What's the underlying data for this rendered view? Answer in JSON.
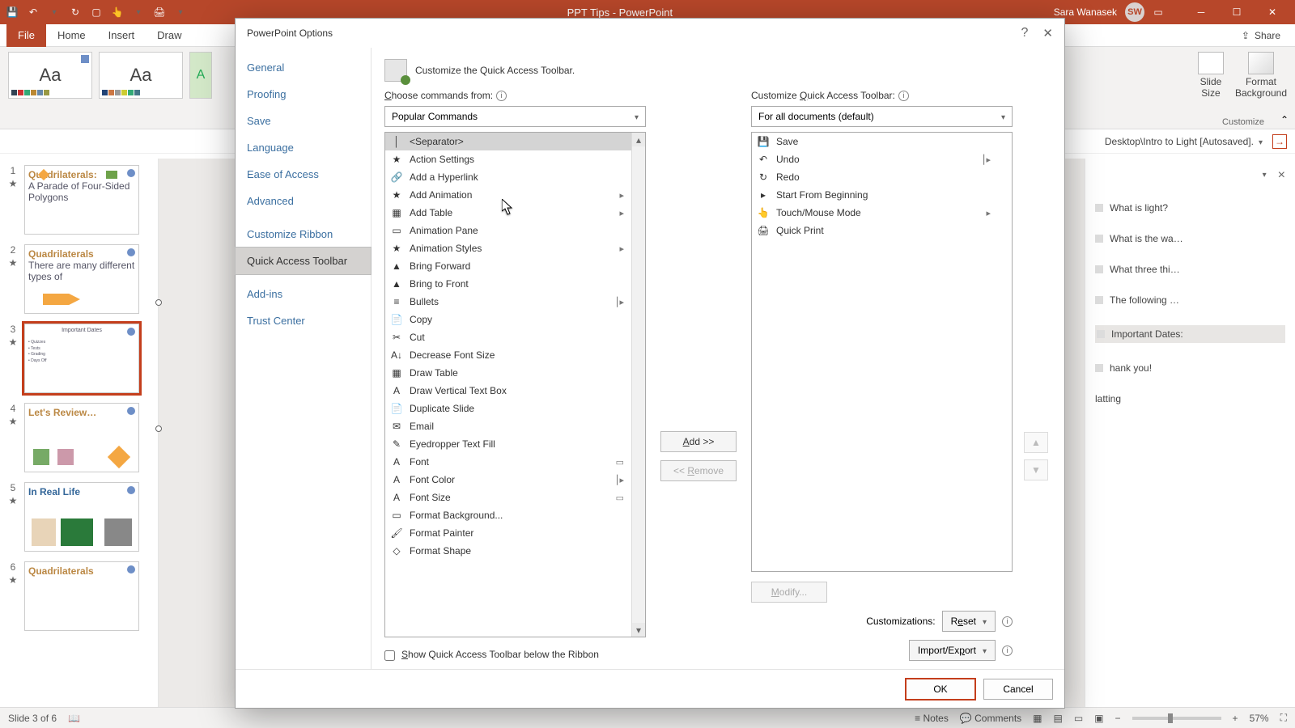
{
  "titlebar": {
    "doc_title": "PPT Tips - PowerPoint",
    "user_name": "Sara Wanasek",
    "user_initials": "SW"
  },
  "ribbon": {
    "tabs": [
      "File",
      "Home",
      "Insert",
      "Draw"
    ],
    "share": "Share",
    "slide_size": "Slide\nSize",
    "format_bg": "Format\nBackground",
    "customize_group": "Customize"
  },
  "filebar": {
    "path": "Desktop\\Intro to Light [Autosaved].",
    "browse": "Browse"
  },
  "taskpane": {
    "close_x": "×",
    "items": [
      "What is light?",
      "What is the wa…",
      "What three thi…",
      "The following …",
      "Important Dates:",
      "hank you!",
      "latting"
    ]
  },
  "thumbs": {
    "count_label": "Slide 3 of 6",
    "slides": [
      {
        "n": "1",
        "title": "Quadrilaterals:",
        "sub": "A Parade of Four-Sided Polygons"
      },
      {
        "n": "2",
        "title": "Quadrilaterals",
        "sub": "There are many different types of"
      },
      {
        "n": "3",
        "title": "Important Dates",
        "sub": ""
      },
      {
        "n": "4",
        "title": "Let's Review…",
        "sub": ""
      },
      {
        "n": "5",
        "title": "In Real Life",
        "sub": ""
      },
      {
        "n": "6",
        "title": "Quadrilaterals",
        "sub": ""
      }
    ]
  },
  "statusbar": {
    "notes": "Notes",
    "comments": "Comments",
    "zoom": "57%"
  },
  "dialog": {
    "title": "PowerPoint Options",
    "sidebar": [
      "General",
      "Proofing",
      "Save",
      "Language",
      "Ease of Access",
      "Advanced",
      "Customize Ribbon",
      "Quick Access Toolbar",
      "Add-ins",
      "Trust Center"
    ],
    "sidebar_selected": "Quick Access Toolbar",
    "heading": "Customize the Quick Access Toolbar.",
    "left_label": "Choose commands from:",
    "left_dropdown": "Popular Commands",
    "right_label": "Customize Quick Access Toolbar:",
    "right_dropdown": "For all documents (default)",
    "left_list": [
      {
        "label": "<Separator>",
        "sel": true
      },
      {
        "label": "Action Settings"
      },
      {
        "label": "Add a Hyperlink"
      },
      {
        "label": "Add Animation",
        "sub": true
      },
      {
        "label": "Add Table",
        "sub": true
      },
      {
        "label": "Animation Pane"
      },
      {
        "label": "Animation Styles",
        "sub": true
      },
      {
        "label": "Bring Forward"
      },
      {
        "label": "Bring to Front"
      },
      {
        "label": "Bullets",
        "sub": true,
        "split": true
      },
      {
        "label": "Copy"
      },
      {
        "label": "Cut"
      },
      {
        "label": "Decrease Font Size"
      },
      {
        "label": "Draw Table"
      },
      {
        "label": "Draw Vertical Text Box"
      },
      {
        "label": "Duplicate Slide"
      },
      {
        "label": "Email"
      },
      {
        "label": "Eyedropper Text Fill"
      },
      {
        "label": "Font",
        "box": true
      },
      {
        "label": "Font Color",
        "sub": true,
        "split": true
      },
      {
        "label": "Font Size",
        "box": true
      },
      {
        "label": "Format Background..."
      },
      {
        "label": "Format Painter"
      },
      {
        "label": "Format Shape"
      }
    ],
    "right_list": [
      {
        "label": "Save"
      },
      {
        "label": "Undo",
        "split": true
      },
      {
        "label": "Redo"
      },
      {
        "label": "Start From Beginning"
      },
      {
        "label": "Touch/Mouse Mode",
        "sub": true
      },
      {
        "label": "Quick Print"
      }
    ],
    "add_btn": "Add >>",
    "remove_btn": "<< Remove",
    "modify_btn": "Modify...",
    "show_below": "Show Quick Access Toolbar below the Ribbon",
    "customizations": "Customizations:",
    "reset": "Reset",
    "import_export": "Import/Export",
    "ok": "OK",
    "cancel": "Cancel"
  }
}
